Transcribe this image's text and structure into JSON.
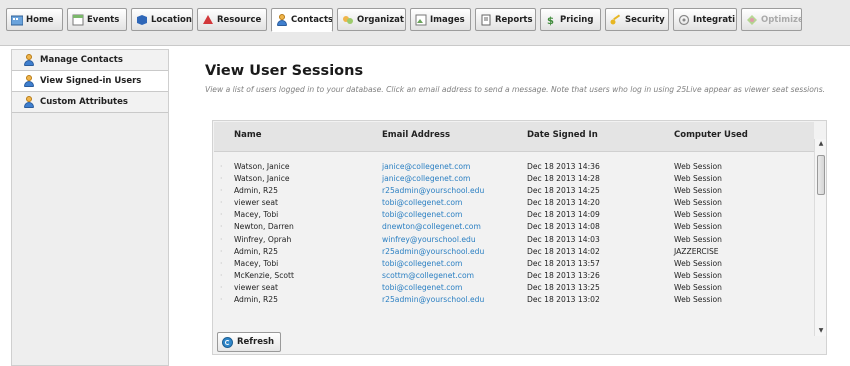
{
  "tabs": [
    {
      "label": "Home",
      "icon": "home-icon",
      "active": false,
      "disabled": false
    },
    {
      "label": "Events",
      "icon": "events-icon",
      "active": false,
      "disabled": false
    },
    {
      "label": "Locations",
      "icon": "locations-icon",
      "active": false,
      "disabled": false
    },
    {
      "label": "Resource",
      "icon": "resource-icon",
      "active": false,
      "disabled": false
    },
    {
      "label": "Contacts",
      "icon": "contacts-icon",
      "active": true,
      "disabled": false
    },
    {
      "label": "Organizat",
      "icon": "organizations-icon",
      "active": false,
      "disabled": false
    },
    {
      "label": "Images",
      "icon": "images-icon",
      "active": false,
      "disabled": false
    },
    {
      "label": "Reports",
      "icon": "reports-icon",
      "active": false,
      "disabled": false
    },
    {
      "label": "Pricing",
      "icon": "pricing-icon",
      "active": false,
      "disabled": false
    },
    {
      "label": "Security",
      "icon": "security-icon",
      "active": false,
      "disabled": false
    },
    {
      "label": "Integrati",
      "icon": "integrations-icon",
      "active": false,
      "disabled": false
    },
    {
      "label": "Optimizer",
      "icon": "optimizer-icon",
      "active": false,
      "disabled": true
    }
  ],
  "sidebar": {
    "items": [
      {
        "label": "Manage Contacts",
        "icon": "person-icon",
        "active": false
      },
      {
        "label": "View Signed-in Users",
        "icon": "person-icon",
        "active": true
      },
      {
        "label": "Custom Attributes",
        "icon": "person-icon",
        "active": false
      }
    ]
  },
  "main": {
    "title": "View User Sessions",
    "description": "View a list of users logged in to your database. Click an email address to send a message. Note that users who log in using 25Live appear as viewer seat sessions."
  },
  "table": {
    "columns": [
      "Name",
      "Email Address",
      "Date Signed In",
      "Computer Used"
    ],
    "rows": [
      {
        "name": "Watson, Janice",
        "email": "janice@collegenet.com",
        "date": "Dec 18 2013 14:36",
        "computer": "Web Session"
      },
      {
        "name": "Watson, Janice",
        "email": "janice@collegenet.com",
        "date": "Dec 18 2013 14:28",
        "computer": "Web Session"
      },
      {
        "name": "Admin, R25",
        "email": "r25admin@yourschool.edu",
        "date": "Dec 18 2013 14:25",
        "computer": "Web Session"
      },
      {
        "name": "viewer seat",
        "email": "tobi@collegenet.com",
        "date": "Dec 18 2013 14:20",
        "computer": "Web Session"
      },
      {
        "name": "Macey, Tobi",
        "email": "tobi@collegenet.com",
        "date": "Dec 18 2013 14:09",
        "computer": "Web Session"
      },
      {
        "name": "Newton, Darren",
        "email": "dnewton@collegenet.com",
        "date": "Dec 18 2013 14:08",
        "computer": "Web Session"
      },
      {
        "name": "Winfrey, Oprah",
        "email": "winfrey@yourschool.edu",
        "date": "Dec 18 2013 14:03",
        "computer": "Web Session"
      },
      {
        "name": "Admin, R25",
        "email": "r25admin@yourschool.edu",
        "date": "Dec 18 2013 14:02",
        "computer": "JAZZERCISE"
      },
      {
        "name": "Macey, Tobi",
        "email": "tobi@collegenet.com",
        "date": "Dec 18 2013 13:57",
        "computer": "Web Session"
      },
      {
        "name": "McKenzie, Scott",
        "email": "scottm@collegenet.com",
        "date": "Dec 18 2013 13:26",
        "computer": "Web Session"
      },
      {
        "name": "viewer seat",
        "email": "tobi@collegenet.com",
        "date": "Dec 18 2013 13:25",
        "computer": "Web Session"
      },
      {
        "name": "Admin, R25",
        "email": "r25admin@yourschool.edu",
        "date": "Dec 18 2013 13:02",
        "computer": "Web Session"
      }
    ]
  },
  "actions": {
    "refresh_label": "Refresh"
  },
  "colors": {
    "link": "#2a7fc2",
    "tabbar": "#e9e9e9",
    "panel": "#f2f2f2"
  }
}
